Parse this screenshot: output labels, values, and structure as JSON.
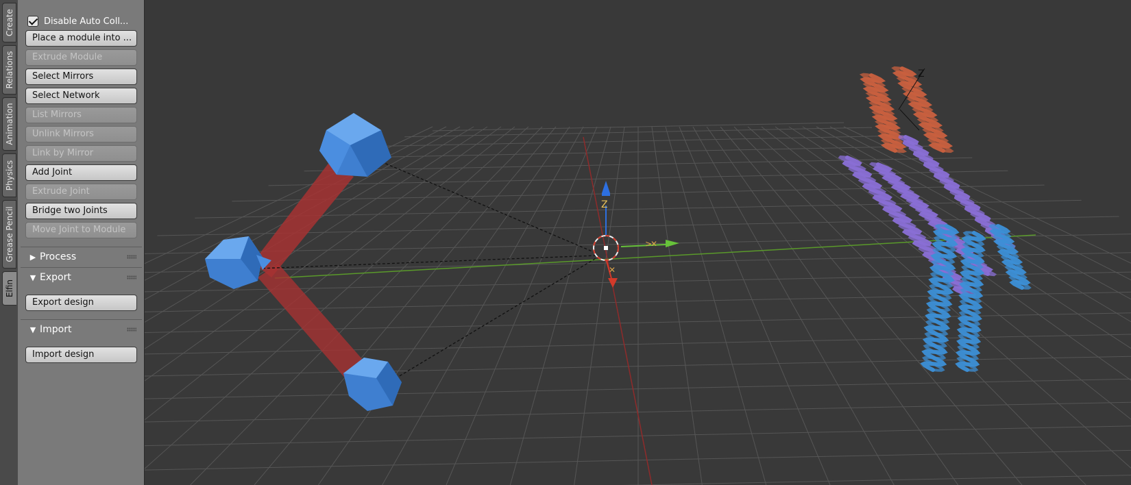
{
  "tabs": [
    {
      "label": "Create"
    },
    {
      "label": "Relations"
    },
    {
      "label": "Animation"
    },
    {
      "label": "Physics"
    },
    {
      "label": "Grease Pencil"
    },
    {
      "label": "Elfin"
    }
  ],
  "panel": {
    "disable_auto_collision": {
      "label": "Disable Auto Coll..."
    },
    "buttons": [
      {
        "label": "Place a module into ..."
      },
      {
        "label": "Extrude Module"
      },
      {
        "label": "Select Mirrors"
      },
      {
        "label": "Select Network"
      },
      {
        "label": "List Mirrors"
      },
      {
        "label": "Unlink Mirrors"
      },
      {
        "label": "Link by Mirror"
      },
      {
        "label": "Add Joint"
      },
      {
        "label": "Extrude Joint"
      },
      {
        "label": "Bridge two Joints"
      },
      {
        "label": "Move Joint to Module"
      }
    ],
    "sections": {
      "process": {
        "label": "Process"
      },
      "export": {
        "label": "Export",
        "button": "Export design"
      },
      "import": {
        "label": "Import",
        "button": "Import design"
      }
    }
  },
  "viewport": {
    "axis_label_z": "Z",
    "protein_label": "Z",
    "colors": {
      "background": "#393939",
      "grid": "#565656",
      "x_axis": "#8f2b2b",
      "y_axis": "#5a9a2a",
      "joint_module": "#3f7fd0",
      "bridge": "#a63232",
      "protein_top": "#c9603f",
      "protein_middle": "#8a6fd6",
      "protein_bottom": "#3c8fd6"
    }
  }
}
